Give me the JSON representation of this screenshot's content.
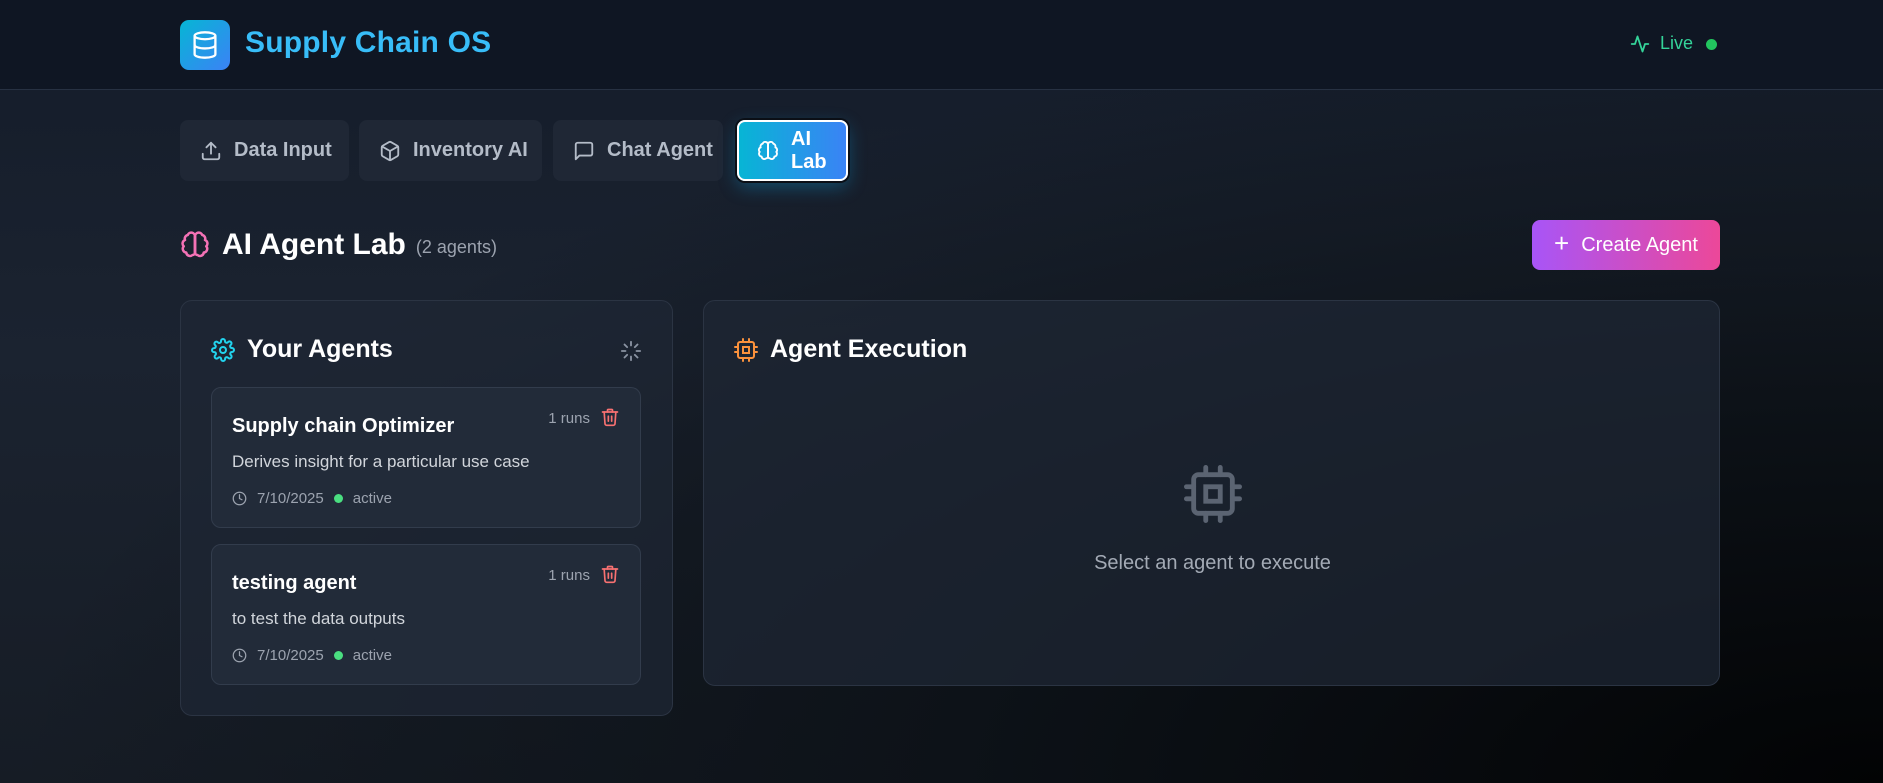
{
  "header": {
    "app_title": "Supply Chain OS",
    "status_label": "Live",
    "status_color": "#22c55e"
  },
  "tabs": [
    {
      "label": "Data Input",
      "icon": "upload-icon",
      "active": false
    },
    {
      "label": "Inventory AI",
      "icon": "package-icon",
      "active": false
    },
    {
      "label": "Chat Agent",
      "icon": "message-square-icon",
      "active": false
    },
    {
      "label": "AI Lab",
      "icon": "brain-icon",
      "active": true
    }
  ],
  "lab": {
    "title": "AI Agent Lab",
    "count": "(2 agents)",
    "create_label": "Create Agent"
  },
  "agents_panel": {
    "title": "Your Agents",
    "agents": [
      {
        "name": "Supply chain Optimizer",
        "description": "Derives insight for a particular use case",
        "date": "7/10/2025",
        "status": "active",
        "runs": "1 runs"
      },
      {
        "name": "testing agent",
        "description": "to test the data outputs",
        "date": "7/10/2025",
        "status": "active",
        "runs": "1 runs"
      }
    ]
  },
  "execution_panel": {
    "title": "Agent Execution",
    "empty_message": "Select an agent to execute"
  },
  "colors": {
    "accent_cyan": "#06b6d4",
    "accent_blue": "#3b82f6",
    "accent_purple": "#a855f7",
    "accent_pink": "#ec4899",
    "danger": "#f87171"
  }
}
